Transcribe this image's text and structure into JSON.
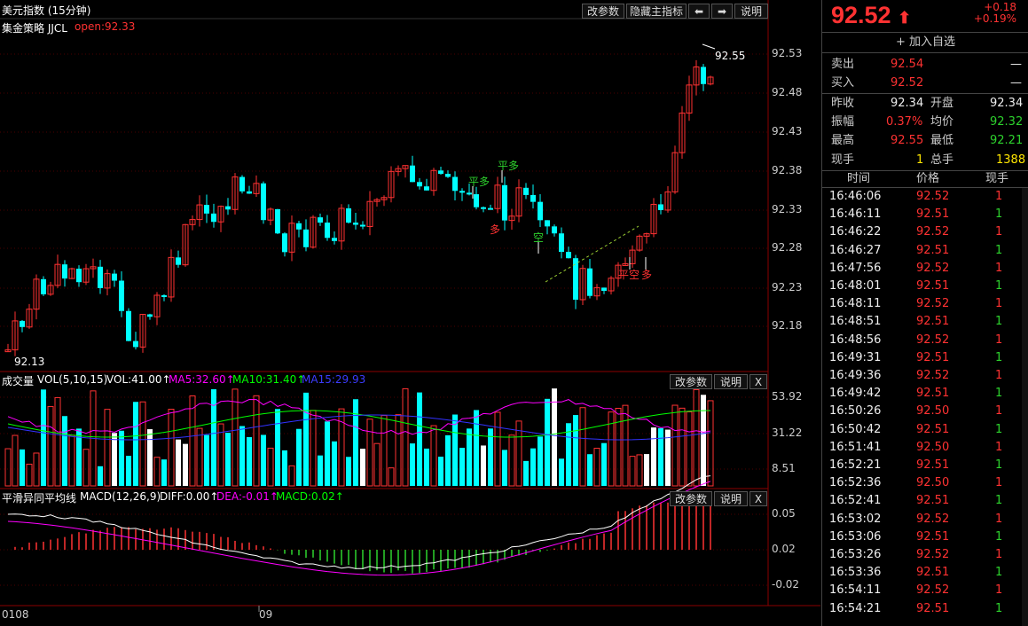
{
  "chart_header": {
    "title": "美元指数 (15分钟)",
    "strategy": "集金策略 JJCL",
    "open_label": "open:92.33"
  },
  "toolbar": {
    "params_label": "改参数",
    "hide_indicator_label": "隐藏主指标",
    "left_arrow": "⬅",
    "right_arrow": "➡",
    "help_label": "说明"
  },
  "price_axis": [
    "92.53",
    "92.48",
    "92.43",
    "92.38",
    "92.33",
    "92.28",
    "92.23",
    "92.18"
  ],
  "annotations": {
    "high": "92.55",
    "low": "92.13",
    "signals": [
      "平多",
      "平多",
      "多",
      "空",
      "平空",
      "多"
    ]
  },
  "volume_panel": {
    "name": "成交量",
    "params": "VOL(5,10,15)",
    "vol": "VOL:41.00↑",
    "ma5": "MA5:32.60↑",
    "ma10": "MA10:31.40↑",
    "ma15": "MA15:29.93",
    "axis": [
      "53.92",
      "31.22",
      "8.51"
    ],
    "params_btn": "改参数",
    "help_btn": "说明",
    "close_btn": "X"
  },
  "macd_panel": {
    "name": "平滑异同平均线",
    "params": "MACD(12,26,9)",
    "diff": "DIFF:0.00↑",
    "dea": "DEA:-0.01↑",
    "macd": "MACD:0.02↑",
    "axis": [
      "0.05",
      "0.02",
      "-0.02"
    ],
    "params_btn": "改参数",
    "help_btn": "说明",
    "close_btn": "X"
  },
  "time_axis": [
    "0108",
    "09"
  ],
  "colors": {
    "up": "#ff3232",
    "down": "#00ffff",
    "ma5": "#ff00ff",
    "ma10": "#00ff00",
    "ma15": "#3232ff",
    "background": "#000000"
  },
  "quote": {
    "price": "92.52",
    "arrow": "⬆",
    "change": "+0.18",
    "change_pct": "+0.19%",
    "add_watchlist": "+ 加入自选",
    "sell_label": "卖出",
    "sell_price": "92.54",
    "sell_vol": "—",
    "buy_label": "买入",
    "buy_price": "92.52",
    "buy_vol": "—",
    "prev_close_label": "昨收",
    "prev_close": "92.34",
    "open_label": "开盘",
    "open": "92.34",
    "amplitude_label": "振幅",
    "amplitude": "0.37%",
    "avg_label": "均价",
    "avg": "92.32",
    "high_label": "最高",
    "high": "92.55",
    "low_label": "最低",
    "low": "92.21",
    "cur_vol_label": "现手",
    "cur_vol": "1",
    "total_vol_label": "总手",
    "total_vol": "1388"
  },
  "ticks_header": {
    "time": "时间",
    "price": "价格",
    "vol": "现手"
  },
  "ticks": [
    {
      "time": "16:46:06",
      "price": "92.52",
      "vol": "1",
      "dir": "up"
    },
    {
      "time": "16:46:11",
      "price": "92.51",
      "vol": "1",
      "dir": "down"
    },
    {
      "time": "16:46:22",
      "price": "92.52",
      "vol": "1",
      "dir": "up"
    },
    {
      "time": "16:46:27",
      "price": "92.51",
      "vol": "1",
      "dir": "down"
    },
    {
      "time": "16:47:56",
      "price": "92.52",
      "vol": "1",
      "dir": "up"
    },
    {
      "time": "16:48:01",
      "price": "92.51",
      "vol": "1",
      "dir": "down"
    },
    {
      "time": "16:48:11",
      "price": "92.52",
      "vol": "1",
      "dir": "up"
    },
    {
      "time": "16:48:51",
      "price": "92.51",
      "vol": "1",
      "dir": "down"
    },
    {
      "time": "16:48:56",
      "price": "92.52",
      "vol": "1",
      "dir": "up"
    },
    {
      "time": "16:49:31",
      "price": "92.51",
      "vol": "1",
      "dir": "down"
    },
    {
      "time": "16:49:36",
      "price": "92.52",
      "vol": "1",
      "dir": "up"
    },
    {
      "time": "16:49:42",
      "price": "92.51",
      "vol": "1",
      "dir": "down"
    },
    {
      "time": "16:50:26",
      "price": "92.50",
      "vol": "1",
      "dir": "up"
    },
    {
      "time": "16:50:42",
      "price": "92.51",
      "vol": "1",
      "dir": "down"
    },
    {
      "time": "16:51:41",
      "price": "92.50",
      "vol": "1",
      "dir": "up"
    },
    {
      "time": "16:52:21",
      "price": "92.51",
      "vol": "1",
      "dir": "down"
    },
    {
      "time": "16:52:36",
      "price": "92.50",
      "vol": "1",
      "dir": "up"
    },
    {
      "time": "16:52:41",
      "price": "92.51",
      "vol": "1",
      "dir": "down"
    },
    {
      "time": "16:53:02",
      "price": "92.52",
      "vol": "1",
      "dir": "up"
    },
    {
      "time": "16:53:06",
      "price": "92.51",
      "vol": "1",
      "dir": "down"
    },
    {
      "time": "16:53:26",
      "price": "92.52",
      "vol": "1",
      "dir": "up"
    },
    {
      "time": "16:53:36",
      "price": "92.51",
      "vol": "1",
      "dir": "down"
    },
    {
      "time": "16:54:11",
      "price": "92.52",
      "vol": "1",
      "dir": "up"
    },
    {
      "time": "16:54:21",
      "price": "92.51",
      "vol": "1",
      "dir": "down"
    }
  ]
}
